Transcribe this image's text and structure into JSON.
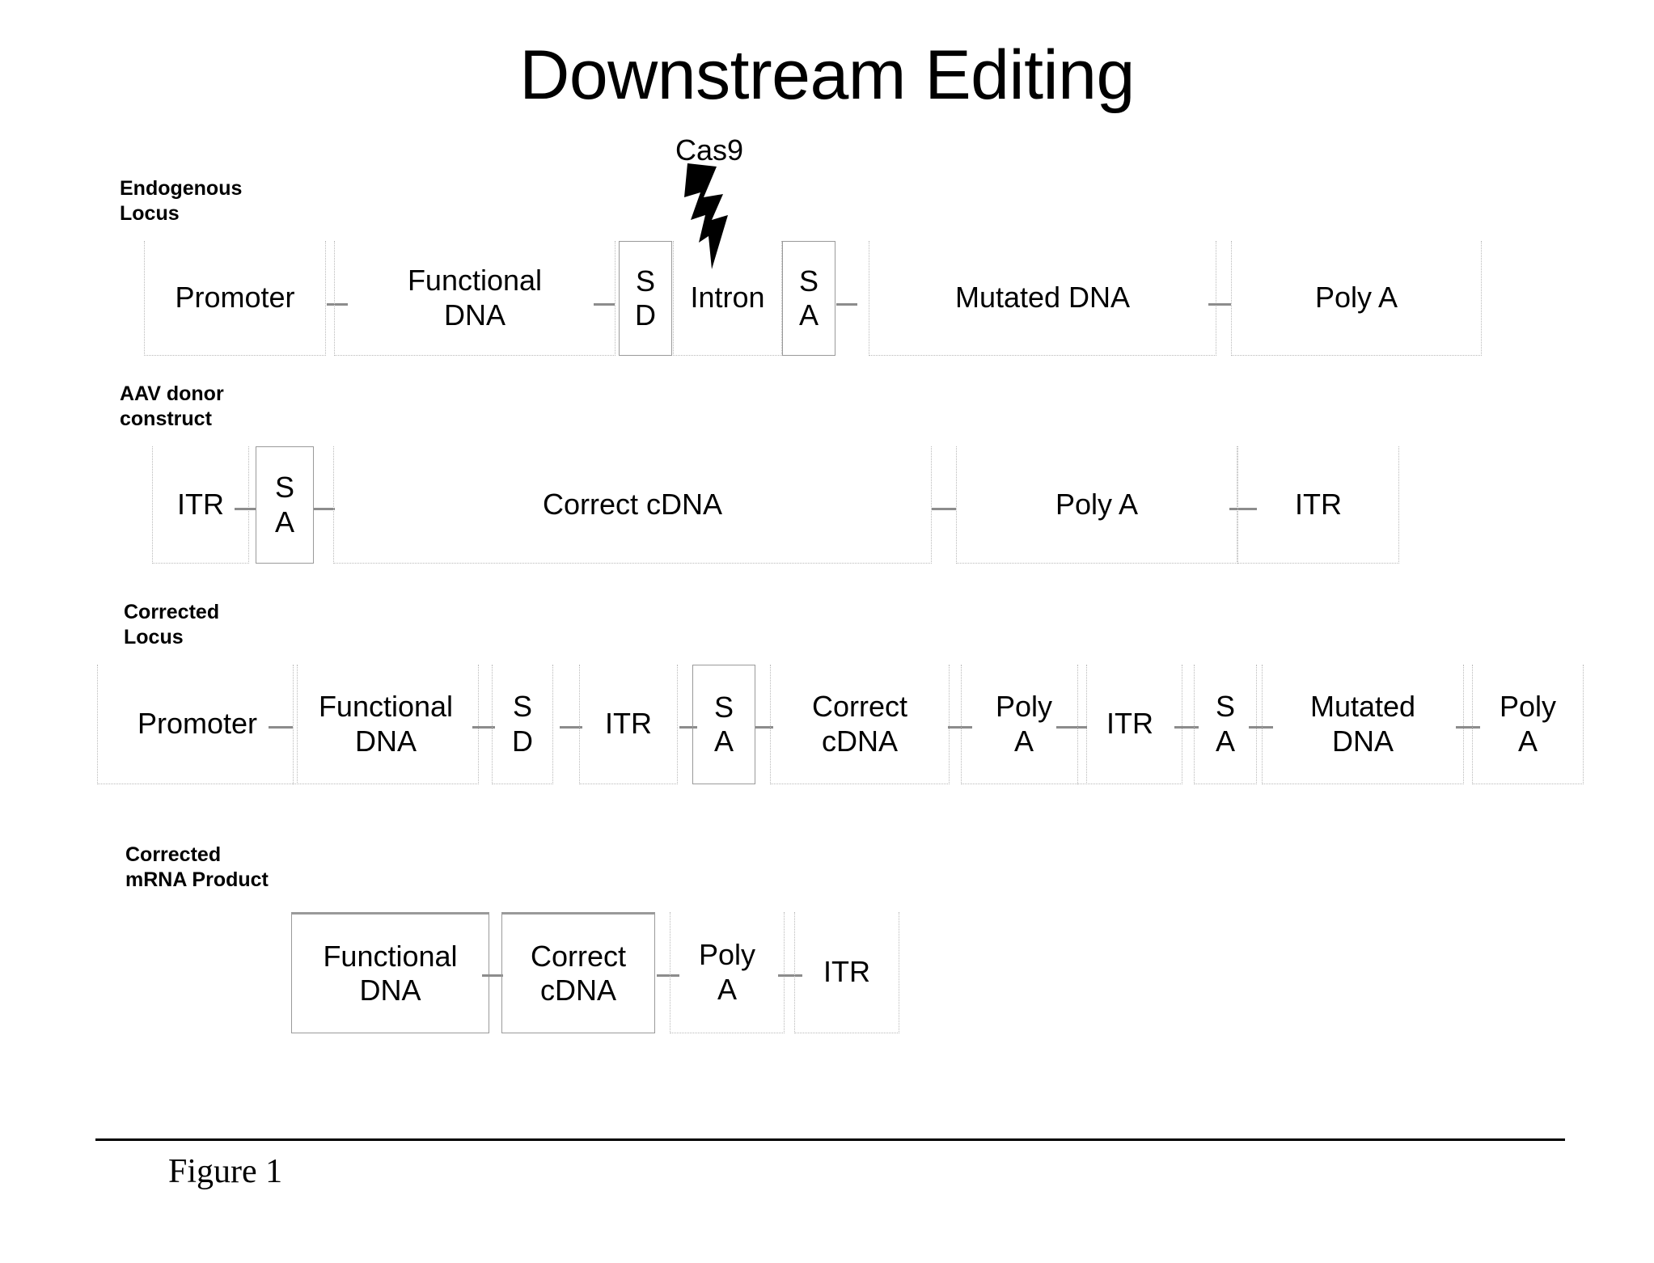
{
  "title": "Downstream Editing",
  "caption": "Figure 1",
  "cas9": {
    "label": "Cas9",
    "icon": "lightning-bolt-icon"
  },
  "rows": [
    {
      "id": "endogenous-locus",
      "label": "Endogenous\nLocus",
      "segments": [
        {
          "name": "promoter",
          "text": "Promoter"
        },
        {
          "name": "functional-dna",
          "text": "Functional\nDNA"
        },
        {
          "name": "splice-donor",
          "text": "S\nD"
        },
        {
          "name": "intron",
          "text": "Intron"
        },
        {
          "name": "splice-acceptor",
          "text": "S\nA"
        },
        {
          "name": "mutated-dna",
          "text": "Mutated DNA"
        },
        {
          "name": "poly-a",
          "text": "Poly A"
        }
      ]
    },
    {
      "id": "aav-donor-construct",
      "label": "AAV donor\nconstruct",
      "segments": [
        {
          "name": "itr-left",
          "text": "ITR"
        },
        {
          "name": "splice-acceptor",
          "text": "S\nA"
        },
        {
          "name": "correct-cdna",
          "text": "Correct cDNA"
        },
        {
          "name": "poly-a",
          "text": "Poly A"
        },
        {
          "name": "itr-right",
          "text": "ITR"
        }
      ]
    },
    {
      "id": "corrected-locus",
      "label": "Corrected\nLocus",
      "segments": [
        {
          "name": "promoter",
          "text": "Promoter"
        },
        {
          "name": "functional-dna",
          "text": "Functional\nDNA"
        },
        {
          "name": "splice-donor",
          "text": "S\nD"
        },
        {
          "name": "itr-1",
          "text": "ITR"
        },
        {
          "name": "splice-acceptor-1",
          "text": "S\nA"
        },
        {
          "name": "correct-cdna",
          "text": "Correct\ncDNA"
        },
        {
          "name": "poly-a-1",
          "text": "Poly\nA"
        },
        {
          "name": "itr-2",
          "text": "ITR"
        },
        {
          "name": "splice-acceptor-2",
          "text": "S\nA"
        },
        {
          "name": "mutated-dna",
          "text": "Mutated\nDNA"
        },
        {
          "name": "poly-a-2",
          "text": "Poly\nA"
        }
      ]
    },
    {
      "id": "corrected-mrna-product",
      "label": "Corrected\nmRNA Product",
      "segments": [
        {
          "name": "functional-dna",
          "text": "Functional\nDNA"
        },
        {
          "name": "correct-cdna",
          "text": "Correct\ncDNA"
        },
        {
          "name": "poly-a",
          "text": "Poly\nA"
        },
        {
          "name": "itr",
          "text": "ITR"
        }
      ]
    }
  ]
}
